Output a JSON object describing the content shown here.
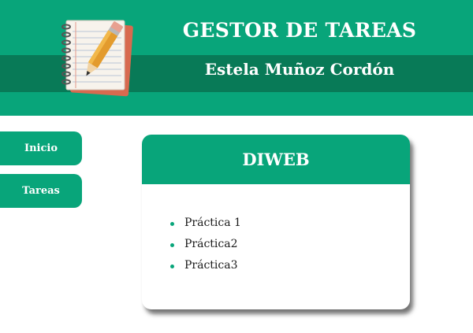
{
  "header": {
    "title": "GESTOR DE TAREAS",
    "user_name": "Estela Muñoz Cordón",
    "logo_icon": "notebook-pencil-icon"
  },
  "nav": {
    "items": [
      {
        "label": "Inicio"
      },
      {
        "label": "Tareas"
      }
    ]
  },
  "card": {
    "title": "DIWEB",
    "tasks": [
      {
        "label": "Práctica 1"
      },
      {
        "label": "Práctica2"
      },
      {
        "label": "Práctica3"
      }
    ]
  },
  "colors": {
    "primary": "#08a57a",
    "primary_dark": "#087a57",
    "text": "#1a1a1a"
  }
}
